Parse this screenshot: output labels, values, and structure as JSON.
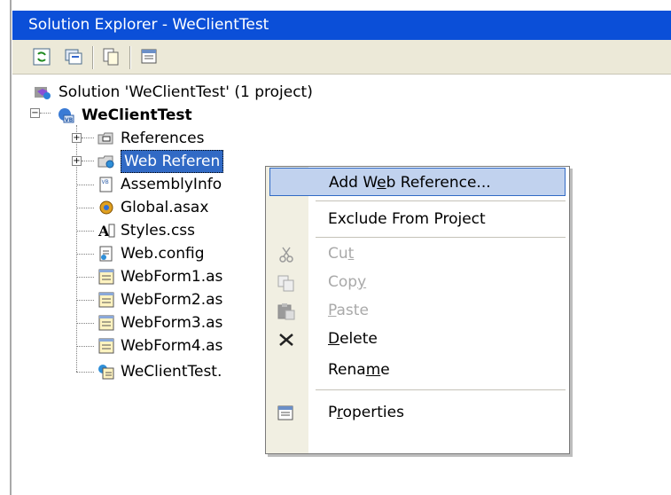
{
  "window": {
    "title": "Solution Explorer - WeClientTest"
  },
  "toolbar": {
    "buttons": [
      "refresh-icon",
      "show-all-files-icon",
      "copy-project-icon",
      "properties-icon"
    ]
  },
  "tree": {
    "solution": "Solution 'WeClientTest' (1 project)",
    "project": "WeClientTest",
    "items": [
      {
        "label": "References"
      },
      {
        "label": "Web Referen"
      },
      {
        "label": "AssemblyInfo"
      },
      {
        "label": "Global.asax"
      },
      {
        "label": "Styles.css"
      },
      {
        "label": "Web.config"
      },
      {
        "label": "WebForm1.as"
      },
      {
        "label": "WebForm2.as"
      },
      {
        "label": "WebForm3.as"
      },
      {
        "label": "WebForm4.as"
      },
      {
        "label": "WeClientTest."
      }
    ]
  },
  "menu": {
    "add_web_reference": {
      "pre": "Add W",
      "key": "e",
      "post": "b Reference..."
    },
    "exclude": "Exclude From Project",
    "cut": {
      "pre": "Cu",
      "key": "t",
      "post": ""
    },
    "copy": {
      "pre": "Cop",
      "key": "y",
      "post": ""
    },
    "paste": {
      "pre": "",
      "key": "P",
      "post": "aste"
    },
    "delete": {
      "pre": "",
      "key": "D",
      "post": "elete"
    },
    "rename": {
      "pre": "Rena",
      "key": "m",
      "post": "e"
    },
    "properties": {
      "pre": "P",
      "key": "r",
      "post": "operties"
    }
  },
  "colors": {
    "titlebar": "#0b4fd8",
    "highlight": "#c1d2ee",
    "selection": "#316ac5"
  }
}
